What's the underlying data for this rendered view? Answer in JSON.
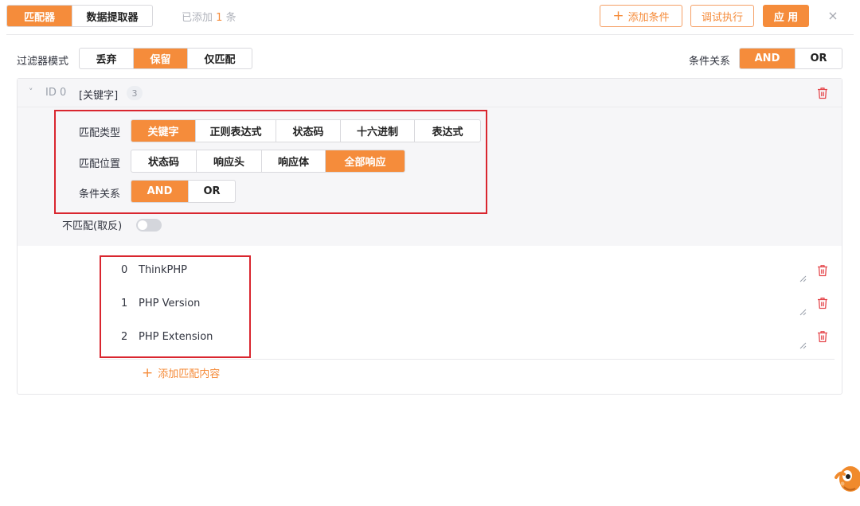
{
  "top": {
    "tabs": [
      {
        "label": "匹配器",
        "active": true
      },
      {
        "label": "数据提取器",
        "active": false
      }
    ],
    "added_prefix": "已添加",
    "added_count": "1",
    "added_suffix": "条",
    "add_condition": "添加条件",
    "debug_run": "调试执行",
    "apply": "应 用",
    "close": "×"
  },
  "filter_mode": {
    "label": "过滤器模式",
    "options": [
      {
        "label": "丢弃",
        "active": false
      },
      {
        "label": "保留",
        "active": true
      },
      {
        "label": "仅匹配",
        "active": false
      }
    ]
  },
  "condition_relation": {
    "label": "条件关系",
    "options": [
      {
        "label": "AND",
        "active": true
      },
      {
        "label": "OR",
        "active": false
      }
    ]
  },
  "matcher": {
    "id_label": "ID 0",
    "type_tag": "[关键字]",
    "count": "3",
    "match_type": {
      "label": "匹配类型",
      "options": [
        {
          "label": "关键字",
          "active": true
        },
        {
          "label": "正则表达式",
          "active": false
        },
        {
          "label": "状态码",
          "active": false
        },
        {
          "label": "十六进制",
          "active": false
        },
        {
          "label": "表达式",
          "active": false
        }
      ]
    },
    "match_position": {
      "label": "匹配位置",
      "options": [
        {
          "label": "状态码",
          "active": false
        },
        {
          "label": "响应头",
          "active": false
        },
        {
          "label": "响应体",
          "active": false
        },
        {
          "label": "全部响应",
          "active": true
        }
      ]
    },
    "relation": {
      "label": "条件关系",
      "options": [
        {
          "label": "AND",
          "active": true
        },
        {
          "label": "OR",
          "active": false
        }
      ]
    },
    "negate_label": "不匹配(取反)",
    "negate_on": false,
    "items": [
      {
        "index": "0",
        "value": "ThinkPHP"
      },
      {
        "index": "1",
        "value": "PHP Version"
      },
      {
        "index": "2",
        "value": "PHP Extension"
      }
    ],
    "add_content": "添加匹配内容"
  },
  "colors": {
    "accent": "#f58c3b",
    "highlight_box": "#d9262f",
    "trash": "#e5484d"
  },
  "icons": [
    "chevron-down-icon",
    "trash-icon",
    "plus-icon",
    "close-icon",
    "resize-handle-icon",
    "mascot-icon"
  ]
}
